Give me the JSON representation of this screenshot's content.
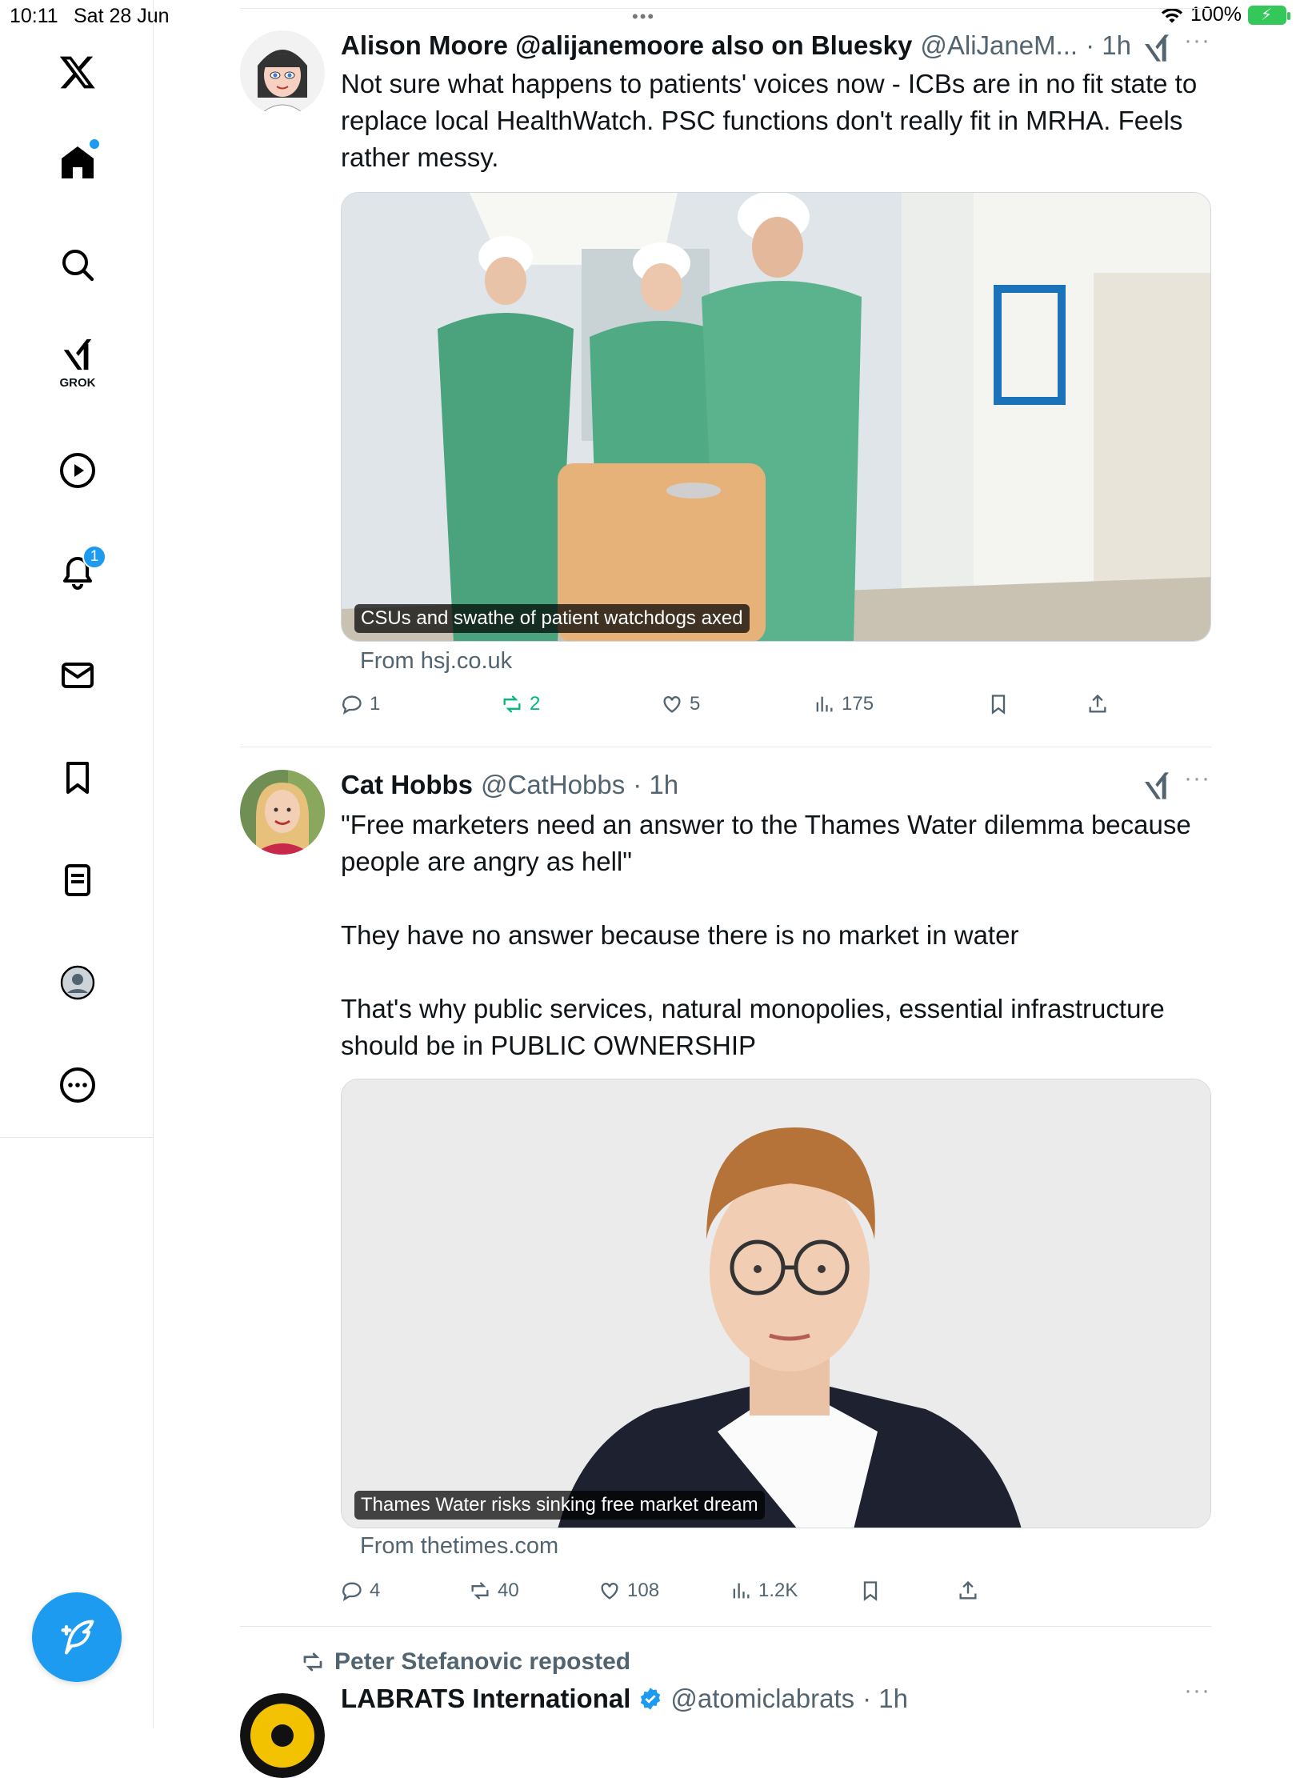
{
  "status": {
    "time": "10:11",
    "date": "Sat 28 Jun",
    "battery": "100%"
  },
  "sidebar": {
    "grok_label": "GROK",
    "notifications_badge": "1"
  },
  "tweets": [
    {
      "name": "Alison Moore @alijanemoore also on Bluesky",
      "handle": "@AliJaneM...",
      "time": "· 1h",
      "text": "Not sure what happens to patients' voices now - ICBs are in no fit state to replace local HealthWatch. PSC functions don't really fit in MRHA. Feels rather messy.",
      "card_caption": "CSUs and swathe of patient watchdogs axed",
      "card_source": "From hsj.co.uk",
      "replies": "1",
      "reposts": "2",
      "likes": "5",
      "views": "175"
    },
    {
      "name": "Cat Hobbs",
      "handle": "@CatHobbs",
      "time": "· 1h",
      "text": "\"Free marketers need an answer to the Thames Water dilemma because people are angry as hell\"\n\nThey have no answer because there is no market in water\n\nThat's why public services, natural monopolies, essential infrastructure should be in PUBLIC OWNERSHIP",
      "card_caption": "Thames Water risks sinking free market dream",
      "card_source": "From thetimes.com",
      "replies": "4",
      "reposts": "40",
      "likes": "108",
      "views": "1.2K"
    },
    {
      "reposted_by": "Peter Stefanovic reposted",
      "name": "LABRATS International",
      "handle": "@atomiclabrats",
      "time": "· 1h"
    }
  ],
  "colors": {
    "accent": "#1d9bf0",
    "repost_green": "#00ba7c",
    "muted": "#536471"
  },
  "icons": [
    "x-logo-icon",
    "home-icon",
    "search-icon",
    "grok-icon",
    "video-icon",
    "bell-icon",
    "mail-icon",
    "bookmark-icon",
    "list-icon",
    "profile-icon",
    "more-icon",
    "compose-icon",
    "reply-icon",
    "repost-icon",
    "like-icon",
    "views-icon",
    "share-icon",
    "verified-icon"
  ]
}
